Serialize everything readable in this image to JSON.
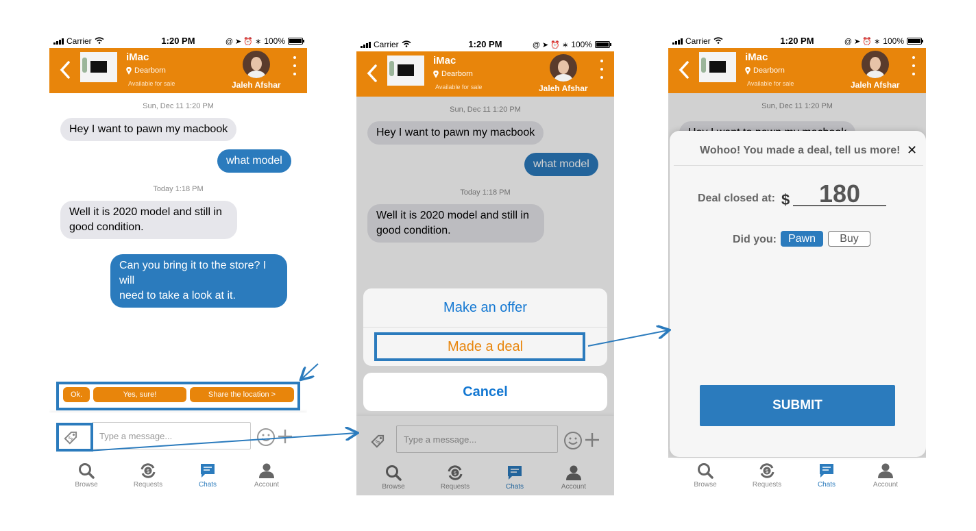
{
  "status": {
    "carrier": "Carrier",
    "time": "1:20 PM",
    "battery": "100%"
  },
  "header": {
    "title": "iMac",
    "location": "Dearborn",
    "availability": "Available for sale",
    "user_name": "Jaleh Afshar"
  },
  "chat": {
    "timestamp_1": "Sun, Dec 11 1:20 PM",
    "msg_1": "Hey I want to pawn my macbook",
    "msg_2": "what model",
    "timestamp_2": "Today 1:18 PM",
    "msg_3_line1": "Well it is 2020 model and still in",
    "msg_3_line2": "good condition.",
    "msg_4_line1": "Can you bring it to the store? I will",
    "msg_4_line2": "need to take a look at it."
  },
  "quick_replies": [
    "Ok.",
    "Yes, sure!",
    "Share the location >"
  ],
  "composer": {
    "placeholder": "Type a message..."
  },
  "tabs": [
    {
      "label": "Browse",
      "icon": "search-icon"
    },
    {
      "label": "Requests",
      "icon": "exchange-dollar-icon"
    },
    {
      "label": "Chats",
      "icon": "chat-icon"
    },
    {
      "label": "Account",
      "icon": "person-icon"
    }
  ],
  "action_sheet": {
    "make_offer": "Make an offer",
    "made_deal": "Made a deal",
    "cancel": "Cancel"
  },
  "deal_modal": {
    "title": "Wohoo! You made a deal, tell us more!",
    "close": "✕",
    "closed_at_label": "Deal closed at:",
    "currency": "$",
    "amount": "180",
    "did_you_label": "Did you:",
    "options": [
      "Pawn",
      "Buy"
    ],
    "submit": "SUBMIT",
    "peek_message": "Hey I want to pawn my macbook"
  },
  "colors": {
    "brand_orange": "#e8850b",
    "accent_blue": "#2b7bbd",
    "ios_blue": "#1478d2"
  }
}
